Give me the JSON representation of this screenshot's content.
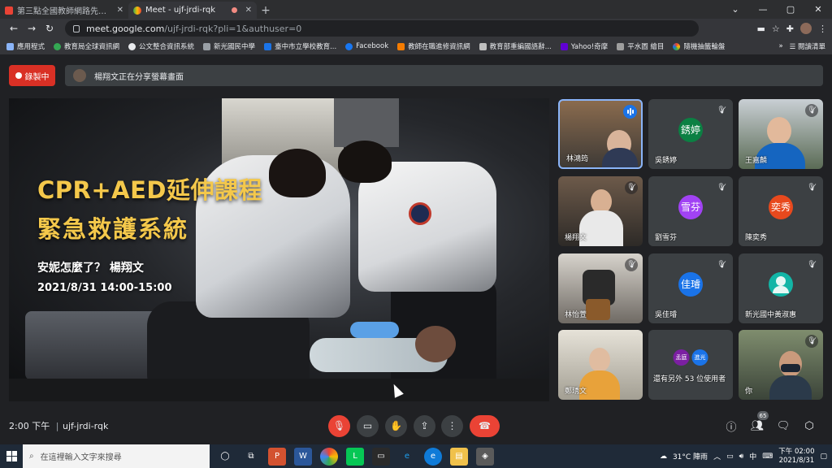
{
  "browser": {
    "tabs": [
      {
        "title": "第三點全國教師網路先行暨停課不停學",
        "active": false
      },
      {
        "title": "Meet - ujf-jrdi-rqk",
        "active": true,
        "recording": true
      }
    ],
    "new_tab_label": "+",
    "window_controls": [
      "—",
      "▢",
      "✕"
    ],
    "url_host": "meet.google.com",
    "url_path": "/ujf-jrdi-rqk?pli=1&authuser=0",
    "bookmarks": [
      "應用程式",
      "教育局全球資訊網",
      "公文整合資訊系統",
      "新光國民中學",
      "臺中市立學校教育...",
      "Facebook",
      "教師在職進修資訊網",
      "教育部重編國語辭...",
      "Yahoo!奇摩",
      "平水圖 繪目",
      "隨機抽籤輪盤"
    ],
    "reading_list": "閱讀清單",
    "more_bookmarks": "»"
  },
  "meet": {
    "recording_label": "錄製中",
    "presenting_notice": "楊翔文正在分享螢幕畫面",
    "slide": {
      "title_line1": "CPR+AED延伸課程",
      "title_line2": "緊急救護系統",
      "subtitle": "安妮怎麼了？ 楊翔文",
      "datetime": "2021/8/31 14:00-15:00"
    },
    "participants": [
      {
        "name": "林鴻筠",
        "type": "video"
      },
      {
        "name": "吳銹婷",
        "initial": "銹婷",
        "color": "#0b8043"
      },
      {
        "name": "王嘉麟",
        "type": "video"
      },
      {
        "name": "楊翔文",
        "type": "video"
      },
      {
        "name": "劉雪芬",
        "initial": "雪芬",
        "color": "#a142f4"
      },
      {
        "name": "陳奕秀",
        "initial": "奕秀",
        "color": "#e8491d"
      },
      {
        "name": "林怡萱",
        "type": "video"
      },
      {
        "name": "吳佳璿",
        "initial": "佳璿",
        "color": "#1a73e8"
      },
      {
        "name": "新光國中黃淑惠",
        "initial": "",
        "color": "#12b5a6"
      },
      {
        "name": "鄭琇文",
        "type": "video"
      },
      {
        "name": "還有另外 53 位使用者",
        "initial_a": "孟庭",
        "initial_b": "進光"
      },
      {
        "name": "你",
        "type": "video"
      }
    ],
    "time": "2:00 下午",
    "separator": "|",
    "meeting_code": "ujf-jrdi-rqk",
    "people_count": "65"
  },
  "taskbar": {
    "search_placeholder": "在這裡輸入文字來搜尋",
    "weather": "31°C 陣雨",
    "ime": "中",
    "clock_time": "下午 02:00",
    "clock_date": "2021/8/31"
  },
  "colors": {
    "meet_bg": "#202124",
    "tile_bg": "#3c4043",
    "recording_red": "#d93025",
    "active_speaker": "#8ab4f8",
    "slide_title": "#f4c84b"
  }
}
